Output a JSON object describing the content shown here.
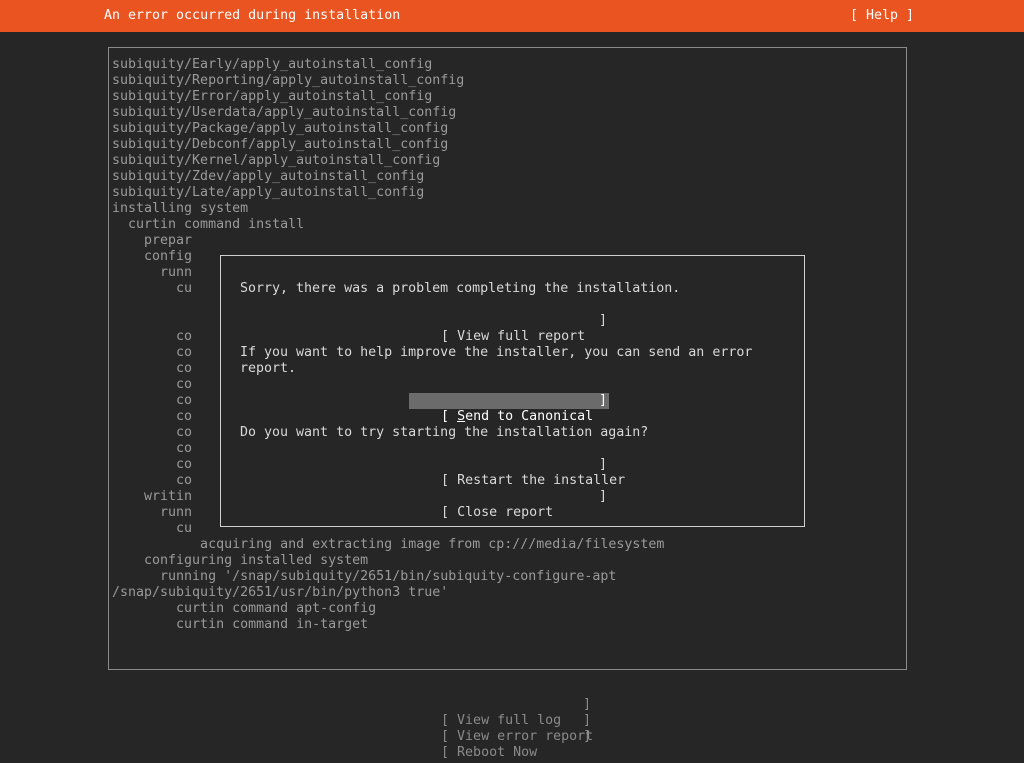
{
  "header": {
    "title": "An error occurred during installation",
    "help_label": "[ Help ]"
  },
  "log": {
    "lines": [
      "subiquity/Early/apply_autoinstall_config",
      "subiquity/Reporting/apply_autoinstall_config",
      "subiquity/Error/apply_autoinstall_config",
      "subiquity/Userdata/apply_autoinstall_config",
      "subiquity/Package/apply_autoinstall_config",
      "subiquity/Debconf/apply_autoinstall_config",
      "subiquity/Kernel/apply_autoinstall_config",
      "subiquity/Zdev/apply_autoinstall_config",
      "subiquity/Late/apply_autoinstall_config",
      "installing system",
      "  curtin command install",
      "    prepar",
      "    config",
      "      runn",
      "        cu",
      "",
      "",
      "        co",
      "        co",
      "        co",
      "        co",
      "        co",
      "        co",
      "        co",
      "        co",
      "        co",
      "        co",
      "    writin",
      "      runn",
      "        cu",
      "           acquiring and extracting image from cp:///media/filesystem",
      "    configuring installed system",
      "      running '/snap/subiquity/2651/bin/subiquity-configure-apt",
      "/snap/subiquity/2651/usr/bin/python3 true'",
      "        curtin command apt-config",
      "        curtin command in-target"
    ]
  },
  "dialog": {
    "message_1": "Sorry, there was a problem completing the installation.",
    "message_2": "If you want to help improve the installer, you can send an error\nreport.",
    "message_3": "Do you want to try starting the installation again?",
    "view_full_report": "View full report",
    "send_to_canonical_first": "S",
    "send_to_canonical_rest": "end to Canonical",
    "restart_installer": "Restart the installer",
    "close_report": "Close report",
    "bracket_open": "[",
    "bracket_close": "]"
  },
  "footer": {
    "view_full_log": "View full log",
    "view_error_report": "View error report",
    "reboot_now": "Reboot Now",
    "bracket_open": "[",
    "bracket_close": "]"
  }
}
